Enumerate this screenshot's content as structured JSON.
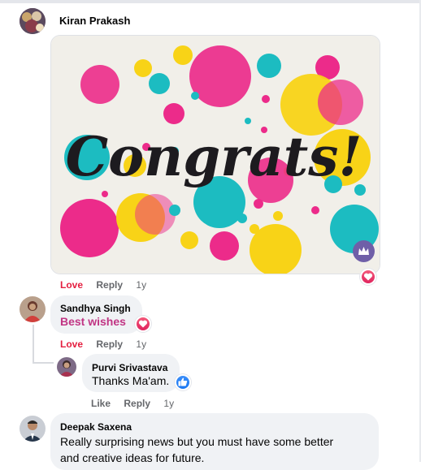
{
  "comments": [
    {
      "author": "Kiran Prakash",
      "image_text": "Congrats!",
      "reaction": "love",
      "actions": {
        "reaction_label": "Love",
        "reply": "Reply",
        "age": "1y"
      }
    },
    {
      "author": "Sandhya Singh",
      "text": "Best wishes",
      "reaction": "love",
      "actions": {
        "reaction_label": "Love",
        "reply": "Reply",
        "age": "1y"
      },
      "replies": [
        {
          "author": "Purvi Srivastava",
          "text": "Thanks Ma'am.",
          "reaction": "like",
          "actions": {
            "reaction_label": "Like",
            "reply": "Reply",
            "age": "1y"
          }
        }
      ]
    },
    {
      "author": "Deepak Saxena",
      "text_line1": "Really surprising news but you must have some better",
      "text_line2": "and creative ideas for future."
    }
  ],
  "colors": {
    "love": "#e41e3f",
    "like": "#1877f2",
    "bubble": "#f0f2f5",
    "meta": "#65676b",
    "highlight_text": "#c13584"
  }
}
